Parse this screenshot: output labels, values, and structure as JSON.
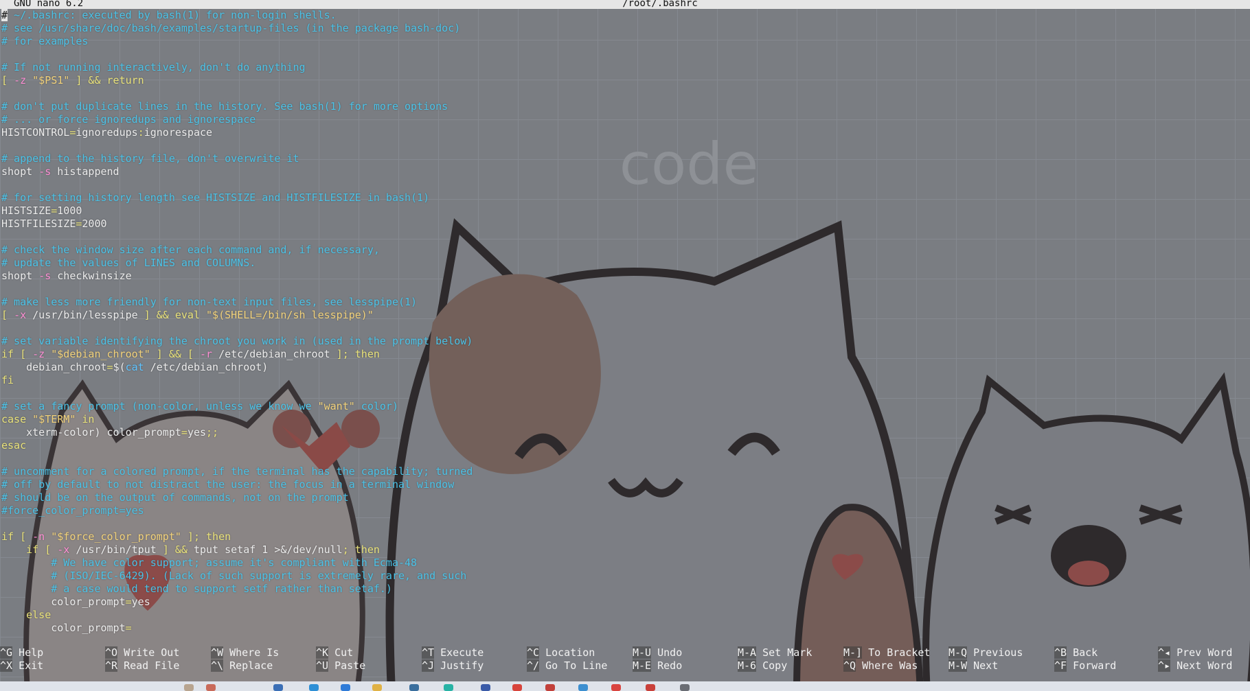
{
  "header": {
    "app_version": "GNU nano 6.2",
    "file_path": "/root/.bashrc"
  },
  "background": {
    "watermark": "code"
  },
  "colors": {
    "comment": "#4bc3e8",
    "keyword": "#e9e27a",
    "string": "#f2d27b",
    "option": "#ff8fd5",
    "command": "#60c4ff",
    "text": "#ececec"
  },
  "editor_lines": [
    [
      [
        "c",
        "# ~/.bashrc: executed by bash(1) for non-login shells."
      ]
    ],
    [
      [
        "c",
        "# see /usr/share/doc/bash/examples/startup-files (in the package bash-doc)"
      ]
    ],
    [
      [
        "c",
        "# for examples"
      ]
    ],
    [
      [
        "t",
        ""
      ]
    ],
    [
      [
        "c",
        "# If not running interactively, don't do anything"
      ]
    ],
    [
      [
        "k",
        "[ "
      ],
      [
        "o",
        "-z"
      ],
      [
        "t",
        " "
      ],
      [
        "s",
        "\"$PS1\""
      ],
      [
        "k",
        " ] && return"
      ]
    ],
    [
      [
        "t",
        ""
      ]
    ],
    [
      [
        "c",
        "# don't put duplicate lines in the history. See bash(1) for more options"
      ]
    ],
    [
      [
        "c",
        "# ... or force ignoredups and ignorespace"
      ]
    ],
    [
      [
        "t",
        "HISTCONTROL"
      ],
      [
        "k",
        "="
      ],
      [
        "t",
        "ignoredups"
      ],
      [
        "k",
        ":"
      ],
      [
        "t",
        "ignorespace"
      ]
    ],
    [
      [
        "t",
        ""
      ]
    ],
    [
      [
        "c",
        "# append to the history file, don't overwrite it"
      ]
    ],
    [
      [
        "t",
        "shopt "
      ],
      [
        "o",
        "-s"
      ],
      [
        "t",
        " histappend"
      ]
    ],
    [
      [
        "t",
        ""
      ]
    ],
    [
      [
        "c",
        "# for setting history length see HISTSIZE and HISTFILESIZE in bash(1)"
      ]
    ],
    [
      [
        "t",
        "HISTSIZE"
      ],
      [
        "k",
        "="
      ],
      [
        "t",
        "1000"
      ]
    ],
    [
      [
        "t",
        "HISTFILESIZE"
      ],
      [
        "k",
        "="
      ],
      [
        "t",
        "2000"
      ]
    ],
    [
      [
        "t",
        ""
      ]
    ],
    [
      [
        "c",
        "# check the window size after each command and, if necessary,"
      ]
    ],
    [
      [
        "c",
        "# update the values of LINES and COLUMNS."
      ]
    ],
    [
      [
        "t",
        "shopt "
      ],
      [
        "o",
        "-s"
      ],
      [
        "t",
        " checkwinsize"
      ]
    ],
    [
      [
        "t",
        ""
      ]
    ],
    [
      [
        "c",
        "# make less more friendly for non-text input files, see lesspipe(1)"
      ]
    ],
    [
      [
        "k",
        "[ "
      ],
      [
        "o",
        "-x"
      ],
      [
        "t",
        " /usr/bin/lesspipe "
      ],
      [
        "k",
        "] && eval "
      ],
      [
        "s",
        "\"$(SHELL=/bin/sh lesspipe)\""
      ]
    ],
    [
      [
        "t",
        ""
      ]
    ],
    [
      [
        "c",
        "# set variable identifying the chroot you work in (used in the prompt below)"
      ]
    ],
    [
      [
        "k",
        "if [ "
      ],
      [
        "o",
        "-z"
      ],
      [
        "t",
        " "
      ],
      [
        "s",
        "\"$debian_chroot\""
      ],
      [
        "k",
        " ] && [ "
      ],
      [
        "o",
        "-r"
      ],
      [
        "t",
        " /etc/debian_chroot "
      ],
      [
        "k",
        "]; then"
      ]
    ],
    [
      [
        "t",
        "    debian_chroot"
      ],
      [
        "k",
        "="
      ],
      [
        "t",
        "$("
      ],
      [
        "b",
        "cat"
      ],
      [
        "t",
        " /etc/debian_chroot)"
      ]
    ],
    [
      [
        "k",
        "fi"
      ]
    ],
    [
      [
        "t",
        ""
      ]
    ],
    [
      [
        "c",
        "# set a fancy prompt (non-color, unless we know we "
      ],
      [
        "s",
        "\"want\""
      ],
      [
        "c",
        " color)"
      ]
    ],
    [
      [
        "k",
        "case "
      ],
      [
        "s",
        "\"$TERM\""
      ],
      [
        "k",
        " in"
      ]
    ],
    [
      [
        "t",
        "    xterm-color) color_prompt"
      ],
      [
        "k",
        "="
      ],
      [
        "t",
        "yes"
      ],
      [
        "k",
        ";;"
      ]
    ],
    [
      [
        "k",
        "esac"
      ]
    ],
    [
      [
        "t",
        ""
      ]
    ],
    [
      [
        "c",
        "# uncomment for a colored prompt, if the terminal has the capability; turned"
      ]
    ],
    [
      [
        "c",
        "# off by default to not distract the user: the focus in a terminal window"
      ]
    ],
    [
      [
        "c",
        "# should be on the output of commands, not on the prompt"
      ]
    ],
    [
      [
        "c",
        "#force_color_prompt=yes"
      ]
    ],
    [
      [
        "t",
        ""
      ]
    ],
    [
      [
        "k",
        "if [ "
      ],
      [
        "o",
        "-n"
      ],
      [
        "t",
        " "
      ],
      [
        "s",
        "\"$force_color_prompt\""
      ],
      [
        "k",
        " ]; then"
      ]
    ],
    [
      [
        "k",
        "    if [ "
      ],
      [
        "o",
        "-x"
      ],
      [
        "t",
        " /usr/bin/tput "
      ],
      [
        "k",
        "] && "
      ],
      [
        "t",
        "tput setaf 1 >&/dev/null"
      ],
      [
        "k",
        "; then"
      ]
    ],
    [
      [
        "c",
        "        # We have color support; assume it's compliant with Ecma-48"
      ]
    ],
    [
      [
        "c",
        "        # (ISO/IEC-6429). (Lack of such support is extremely rare, and such"
      ]
    ],
    [
      [
        "c",
        "        # a case would tend to support setf rather than setaf.)"
      ]
    ],
    [
      [
        "t",
        "        color_prompt"
      ],
      [
        "k",
        "="
      ],
      [
        "t",
        "yes"
      ]
    ],
    [
      [
        "k",
        "    else"
      ]
    ],
    [
      [
        "t",
        "        color_prompt"
      ],
      [
        "k",
        "="
      ]
    ]
  ],
  "shortcuts": [
    {
      "top_key": "^G",
      "top_label": "Help",
      "bottom_key": "^X",
      "bottom_label": "Exit"
    },
    {
      "top_key": "^O",
      "top_label": "Write Out",
      "bottom_key": "^R",
      "bottom_label": "Read File"
    },
    {
      "top_key": "^W",
      "top_label": "Where Is",
      "bottom_key": "^\\",
      "bottom_label": "Replace"
    },
    {
      "top_key": "^K",
      "top_label": "Cut",
      "bottom_key": "^U",
      "bottom_label": "Paste"
    },
    {
      "top_key": "^T",
      "top_label": "Execute",
      "bottom_key": "^J",
      "bottom_label": "Justify"
    },
    {
      "top_key": "^C",
      "top_label": "Location",
      "bottom_key": "^/",
      "bottom_label": "Go To Line"
    },
    {
      "top_key": "M-U",
      "top_label": "Undo",
      "bottom_key": "M-E",
      "bottom_label": "Redo"
    },
    {
      "top_key": "M-A",
      "top_label": "Set Mark",
      "bottom_key": "M-6",
      "bottom_label": "Copy"
    },
    {
      "top_key": "M-]",
      "top_label": "To Bracket",
      "bottom_key": "^Q",
      "bottom_label": "Where Was"
    },
    {
      "top_key": "M-Q",
      "top_label": "Previous",
      "bottom_key": "M-W",
      "bottom_label": "Next"
    },
    {
      "top_key": "^B",
      "top_label": "Back",
      "bottom_key": "^F",
      "bottom_label": "Forward"
    },
    {
      "top_key": "^◂",
      "top_label": "Prev Word",
      "bottom_key": "^▸",
      "bottom_label": "Next Word"
    }
  ]
}
